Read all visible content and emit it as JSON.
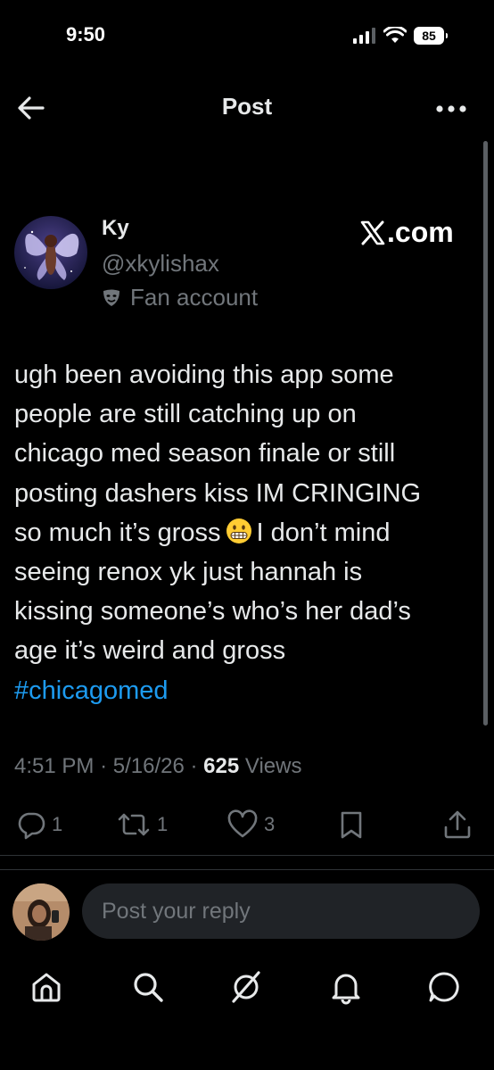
{
  "status_bar": {
    "time": "9:50",
    "battery": "85"
  },
  "header": {
    "title": "Post",
    "back_icon": "arrow-left-icon",
    "more_icon": "more-horizontal-icon"
  },
  "post": {
    "author": {
      "name": "Ky",
      "handle": "@xkylishax",
      "label": "Fan account"
    },
    "watermark": ".com",
    "text_lines": [
      "ugh been avoiding this app some",
      "people are still catching up on",
      "chicago med season finale or still",
      "posting dashers kiss IM CRINGING",
      "so much it’s gross",
      "I don’t mind",
      "seeing renox yk just hannah is",
      "kissing someone’s who’s her dad’s",
      "age it’s weird and gross"
    ],
    "hashtag": "#chicagomed",
    "time": "4:51 PM",
    "date": "5/16/26",
    "views_count": "625",
    "views_label": "Views",
    "separator": "·",
    "stats": {
      "replies": "1",
      "reposts": "1",
      "likes": "3"
    }
  },
  "reply": {
    "placeholder": "Post your reply"
  },
  "nav": {
    "items": [
      "home-icon",
      "search-icon",
      "grok-icon",
      "notifications-icon",
      "messages-icon"
    ]
  },
  "colors": {
    "background": "#000000",
    "text": "#e7e9ea",
    "secondary": "#71767b",
    "link": "#1d9bf0",
    "input_bg": "#202327"
  }
}
